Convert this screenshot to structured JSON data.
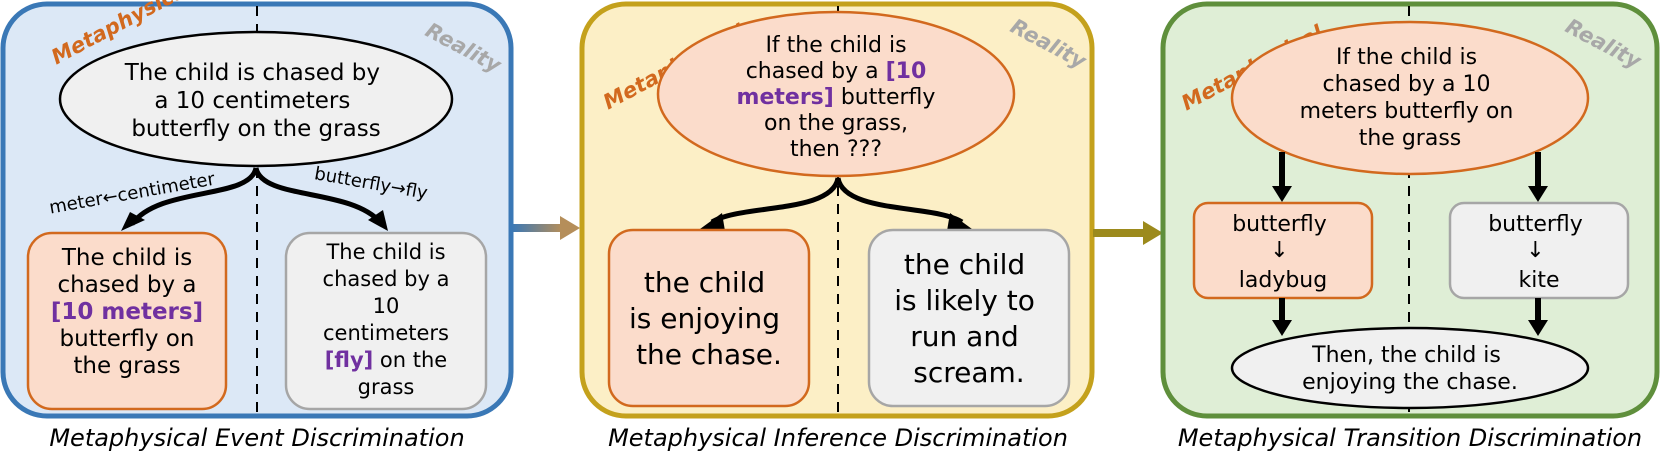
{
  "panels": [
    {
      "title": "Metaphysical Event Discrimination",
      "colors": {
        "bg": "#dce8f6",
        "border": "#3a78b6"
      },
      "labels": {
        "metaphysical": "Metaphysical",
        "reality": "Reality"
      },
      "top_node": {
        "lines": [
          "The child is chased by",
          "a 10 centimeters",
          "butterfly on the grass"
        ]
      },
      "edge_left_label": "meter←centimeter",
      "edge_right_label": "butterfly→fly",
      "left_box": {
        "lines": [
          [
            "The child is"
          ],
          [
            "chased by a"
          ],
          [
            {
              "t": "[10 meters]",
              "h": true
            }
          ],
          [
            "butterfly on"
          ],
          [
            "the grass"
          ]
        ]
      },
      "right_box": {
        "lines": [
          [
            "The child is"
          ],
          [
            "chased by a"
          ],
          [
            "10"
          ],
          [
            "centimeters"
          ],
          [
            {
              "t": "[fly]",
              "h": true
            },
            {
              "t": " on the"
            }
          ],
          [
            "grass"
          ]
        ]
      }
    },
    {
      "title": "Metaphysical Inference Discrimination",
      "colors": {
        "bg": "#fcefc6",
        "border": "#c4a11c"
      },
      "labels": {
        "metaphysical": "Metaphysical",
        "reality": "Reality"
      },
      "top_node": {
        "lines": [
          [
            "If the child is"
          ],
          [
            {
              "t": "chased by a "
            },
            {
              "t": "[10",
              "h": true
            }
          ],
          [
            {
              "t": "meters]",
              "h": true
            },
            {
              "t": " butterfly"
            }
          ],
          [
            "on the grass,"
          ],
          [
            "then ???"
          ]
        ]
      },
      "left_box": {
        "lines": [
          "the child",
          "is enjoying",
          "the chase."
        ]
      },
      "right_box": {
        "lines": [
          "the child",
          "is likely to",
          "run and",
          "scream."
        ]
      }
    },
    {
      "title": "Metaphysical Transition Discrimination",
      "colors": {
        "bg": "#dfeed6",
        "border": "#5f8f3c"
      },
      "labels": {
        "metaphysical": "Metaphysical",
        "reality": "Reality"
      },
      "top_node": {
        "lines": [
          "If the child is",
          "chased by a 10",
          "meters butterfly on",
          "the grass"
        ]
      },
      "left_box": {
        "lines": [
          "butterfly",
          "↓",
          "ladybug"
        ]
      },
      "right_box": {
        "lines": [
          "butterfly",
          "↓",
          "kite"
        ]
      },
      "bottom_node": {
        "lines": [
          "Then, the child is",
          "enjoying the chase."
        ]
      }
    }
  ],
  "colors": {
    "metaphysical_label": "#d2691e",
    "reality_label": "#a8a8a8",
    "highlight": "#7030a0",
    "ellipse_gray": "#f0f0f0",
    "ellipse_peach": "#fbdccb",
    "box_peach": "#fbdccb",
    "box_peach_border": "#d2691e",
    "box_gray": "#f0f0f0",
    "box_gray_border": "#a6a6a6",
    "arrow_1_start": "#3a78b6",
    "arrow_1_end": "#b58e5a",
    "arrow_2": "#9c8a1c"
  }
}
